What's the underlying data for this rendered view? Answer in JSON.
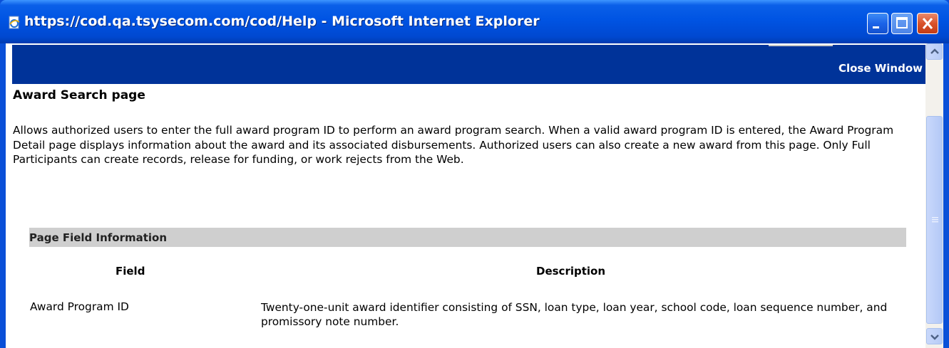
{
  "window": {
    "title": "https://cod.qa.tsysecom.com/cod/Help - Microsoft Internet Explorer",
    "icon": "ie-page-icon",
    "controls": [
      "minimize-icon",
      "maximize-icon",
      "close-icon"
    ]
  },
  "topbar": {
    "close_label": "Close Window"
  },
  "page": {
    "heading": "Award Search page",
    "paragraph": "Allows authorized users to enter the full award program ID to perform an award program search. When a valid award program ID is entered, the Award Program Detail page displays information about the award and its associated disbursements. Authorized users can also create a new award from this page. Only Full Participants can create records, release for funding, or work rejects from the Web."
  },
  "field_info": {
    "section_title": "Page Field Information",
    "columns": [
      "Field",
      "Description"
    ],
    "rows": [
      {
        "field": "Award Program ID",
        "description": "Twenty-one-unit award identifier consisting of SSN, loan type, loan year, school code, loan sequence number, and promissory note number."
      }
    ]
  },
  "colors": {
    "titlebar": "#0054e3",
    "topbar": "#003399",
    "section_band": "#cfcfcf",
    "close_button": "#d9532b"
  }
}
